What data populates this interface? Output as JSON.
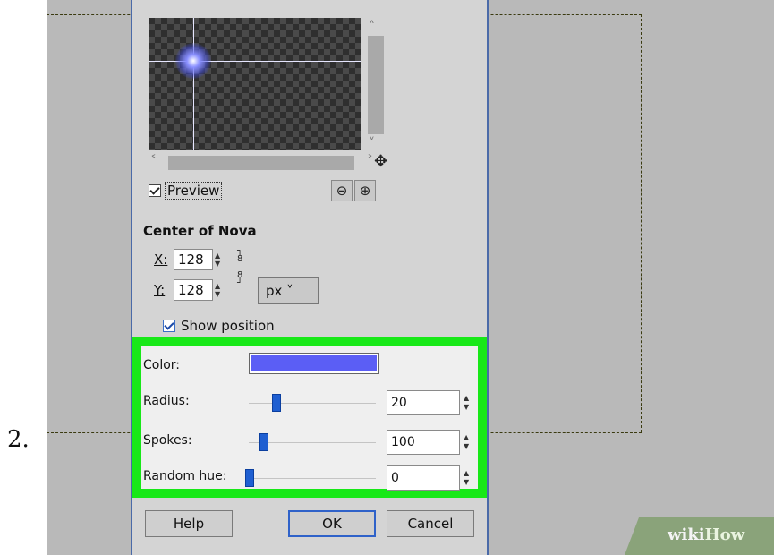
{
  "step": {
    "number": "2."
  },
  "dialog": {
    "preview_label": "Preview",
    "preview_checked": true,
    "section_title": "Center of Nova",
    "x_label": "X:",
    "x_value": "128",
    "y_label": "Y:",
    "y_value": "128",
    "unit": "px",
    "show_position_label": "Show position",
    "show_position_checked": true
  },
  "settings": {
    "color_label": "Color:",
    "color_value": "#5b5ef5",
    "radius_label": "Radius:",
    "radius_value": "20",
    "spokes_label": "Spokes:",
    "spokes_value": "100",
    "random_hue_label": "Random hue:",
    "random_hue_value": "0",
    "highlight_color": "#18e818"
  },
  "buttons": {
    "help": "Help",
    "ok": "OK",
    "cancel": "Cancel"
  },
  "watermark": {
    "text_a": "wiki",
    "text_b": "How"
  },
  "icons": {
    "move": "move-icon",
    "zoom_out": "zoom-out-icon",
    "zoom_in": "zoom-in-icon",
    "chain": "chain-icon"
  }
}
